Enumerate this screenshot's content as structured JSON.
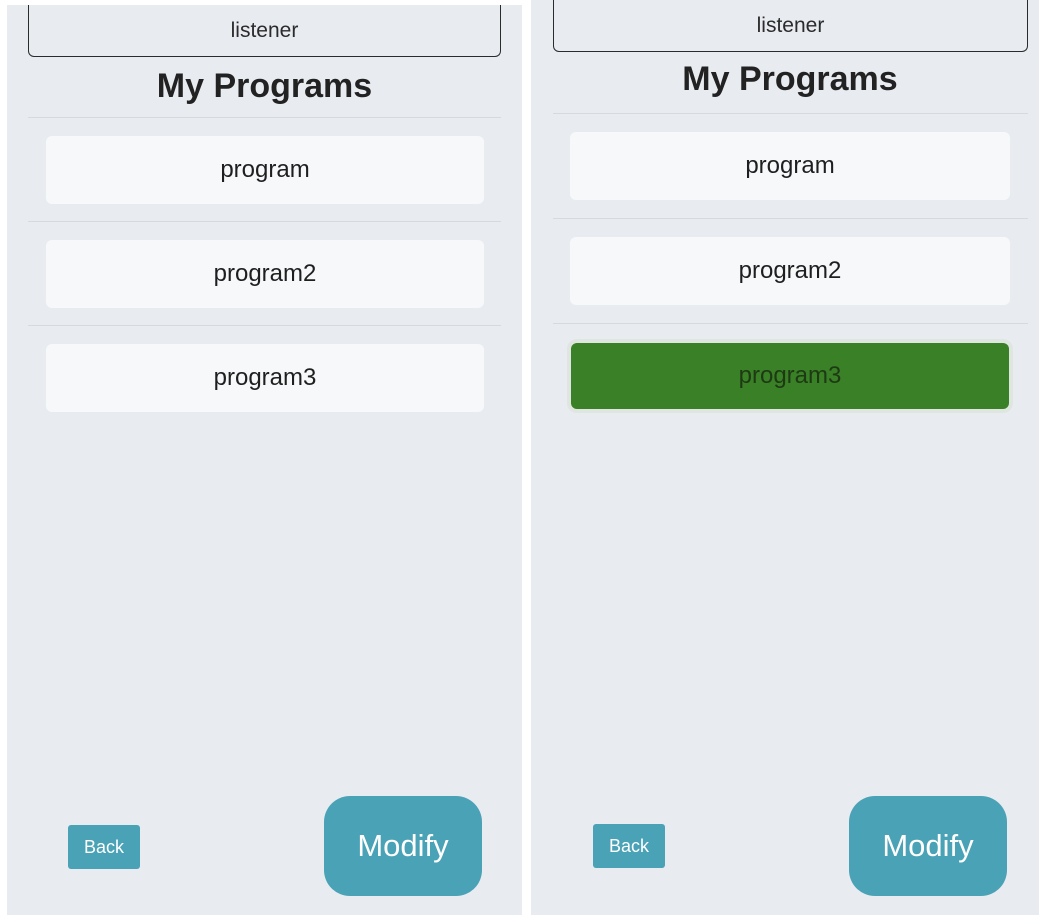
{
  "screens": [
    {
      "listener_label": "listener",
      "title": "My Programs",
      "programs": [
        {
          "name": "program",
          "selected": false
        },
        {
          "name": "program2",
          "selected": false
        },
        {
          "name": "program3",
          "selected": false
        }
      ],
      "back_label": "Back",
      "modify_label": "Modify"
    },
    {
      "listener_label": "listener",
      "title": "My Programs",
      "programs": [
        {
          "name": "program",
          "selected": false
        },
        {
          "name": "program2",
          "selected": false
        },
        {
          "name": "program3",
          "selected": true
        }
      ],
      "back_label": "Back",
      "modify_label": "Modify"
    }
  ],
  "colors": {
    "background": "#e8ebf0",
    "item_background": "#f6f8fa",
    "selected_item": "#3a8026",
    "button_accent": "#4aa2b6"
  }
}
